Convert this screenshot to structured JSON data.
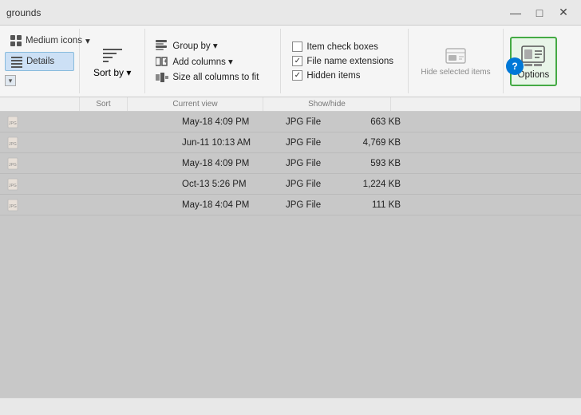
{
  "window": {
    "title": "grounds",
    "controls": {
      "minimize": "—",
      "maximize": "□",
      "close": "✕"
    }
  },
  "ribbon": {
    "nav_buttons": [
      {
        "label": "Medium icons",
        "icon": "grid-icon"
      },
      {
        "label": "Details",
        "icon": "details-icon"
      }
    ],
    "sort": {
      "label": "Sort by ▾",
      "section_label": "Sort"
    },
    "current_view": {
      "buttons": [
        {
          "label": "Group by ▾",
          "icon": "group-icon"
        },
        {
          "label": "Add columns ▾",
          "icon": "add-col-icon"
        },
        {
          "label": "Size all columns to fit",
          "icon": "size-col-icon"
        }
      ],
      "section_label": "Current view"
    },
    "show_hide": {
      "items": [
        {
          "label": "Item check boxes",
          "checked": false
        },
        {
          "label": "File name extensions",
          "checked": true
        },
        {
          "label": "Hidden items",
          "checked": true
        }
      ],
      "section_label": "Show/hide"
    },
    "hide_selected": {
      "label": "Hide selected items",
      "section_label": ""
    },
    "options": {
      "label": "Options",
      "icon": "options-icon"
    }
  },
  "files": {
    "rows": [
      {
        "name": "",
        "date": "May-18 4:09 PM",
        "type": "JPG File",
        "size": "663 KB"
      },
      {
        "name": "",
        "date": "Jun-11 10:13 AM",
        "type": "JPG File",
        "size": "4,769 KB"
      },
      {
        "name": "",
        "date": "May-18 4:09 PM",
        "type": "JPG File",
        "size": "593 KB"
      },
      {
        "name": "",
        "date": "Oct-13 5:26 PM",
        "type": "JPG File",
        "size": "1,224 KB"
      },
      {
        "name": "",
        "date": "May-18 4:04 PM",
        "type": "JPG File",
        "size": "111 KB"
      }
    ]
  },
  "status": {
    "text": ""
  }
}
